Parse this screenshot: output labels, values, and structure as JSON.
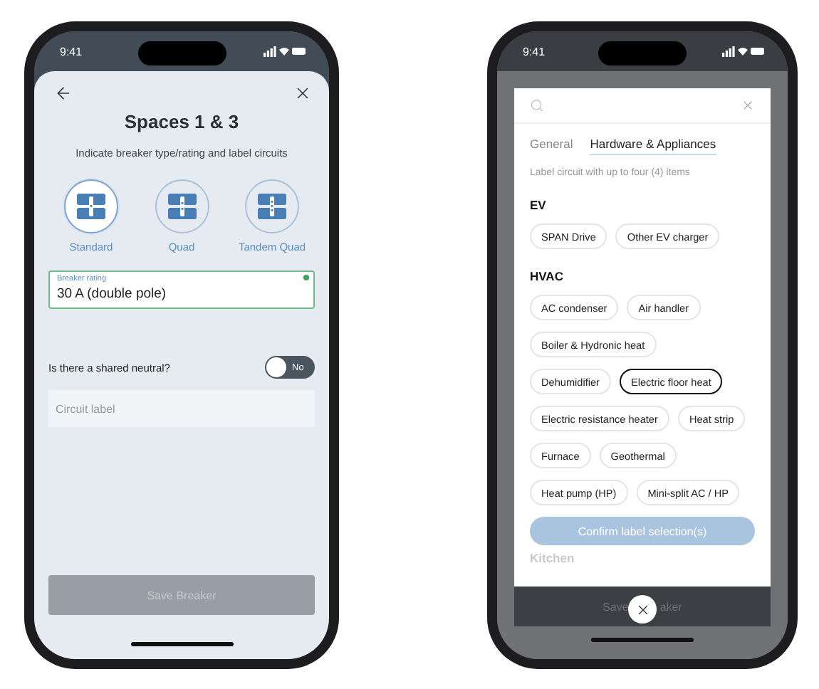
{
  "left_screen": {
    "status_time": "9:41",
    "title": "Spaces 1 & 3",
    "subtitle": "Indicate breaker type/rating and label circuits",
    "breaker_types": [
      {
        "label": "Standard",
        "kind": "standard",
        "selected": true
      },
      {
        "label": "Quad",
        "kind": "quad",
        "selected": false
      },
      {
        "label": "Tandem Quad",
        "kind": "tandem",
        "selected": false
      }
    ],
    "rating_field": {
      "label": "Breaker rating",
      "value": "30 A (double pole)",
      "valid": true
    },
    "shared_neutral": {
      "question": "Is there a shared neutral?",
      "on": false,
      "state_label": "No"
    },
    "circuit_label": {
      "placeholder": "Circuit label"
    },
    "save_button": {
      "label": "Save Breaker",
      "disabled": true
    }
  },
  "right_screen": {
    "status_time": "9:41",
    "tabs": [
      {
        "label": "General",
        "selected": false
      },
      {
        "label": "Hardware & Appliances",
        "selected": true
      }
    ],
    "hint": "Label circuit with up to four (4) items",
    "groups": [
      {
        "heading": "EV",
        "chip_rows": [
          [
            {
              "label": "SPAN Drive",
              "selected": false
            },
            {
              "label": "Other EV charger",
              "selected": false
            }
          ]
        ]
      },
      {
        "heading": "HVAC",
        "chip_rows": [
          [
            {
              "label": "AC condenser",
              "selected": false
            },
            {
              "label": "Air handler",
              "selected": false
            }
          ],
          [
            {
              "label": "Boiler & Hydronic heat",
              "selected": false
            }
          ],
          [
            {
              "label": "Dehumidifier",
              "selected": false
            },
            {
              "label": "Electric floor heat",
              "selected": true
            }
          ],
          [
            {
              "label": "Electric resistance heater",
              "selected": false
            },
            {
              "label": "Heat strip",
              "selected": false
            }
          ],
          [
            {
              "label": "Furnace",
              "selected": false
            },
            {
              "label": "Geothermal",
              "selected": false
            }
          ],
          [
            {
              "label": "Heat pump (HP)",
              "selected": false
            },
            {
              "label": "Mini-split AC / HP",
              "selected": false
            }
          ]
        ]
      }
    ],
    "confirm_button": {
      "label": "Confirm label selection(s)"
    },
    "next_heading": "Kitchen",
    "covered_button_parts": [
      "Save",
      "aker"
    ]
  }
}
